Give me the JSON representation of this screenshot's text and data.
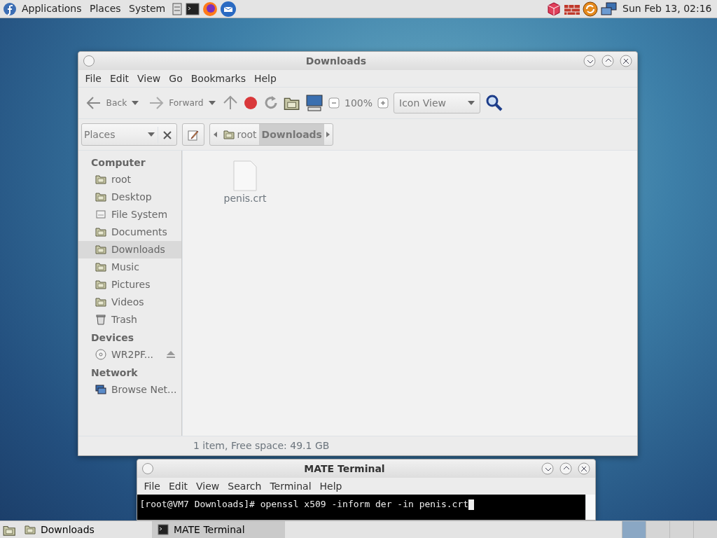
{
  "top_panel": {
    "menus": [
      "Applications",
      "Places",
      "System"
    ],
    "clock": "Sun Feb 13, 02:16"
  },
  "file_manager": {
    "title": "Downloads",
    "menu": [
      "File",
      "Edit",
      "View",
      "Go",
      "Bookmarks",
      "Help"
    ],
    "toolbar": {
      "back": "Back",
      "forward": "Forward",
      "zoom": "100%",
      "view": "Icon View"
    },
    "location": {
      "places": "Places",
      "path": [
        {
          "label": "root",
          "selected": false
        },
        {
          "label": "Downloads",
          "selected": true
        }
      ]
    },
    "sidebar": [
      {
        "heading": "Computer",
        "items": [
          {
            "label": "root",
            "kind": "home",
            "selected": false
          },
          {
            "label": "Desktop",
            "kind": "folder",
            "selected": false
          },
          {
            "label": "File System",
            "kind": "drive",
            "selected": false
          },
          {
            "label": "Documents",
            "kind": "folder",
            "selected": false
          },
          {
            "label": "Downloads",
            "kind": "folder",
            "selected": true
          },
          {
            "label": "Music",
            "kind": "folder",
            "selected": false
          },
          {
            "label": "Pictures",
            "kind": "folder",
            "selected": false
          },
          {
            "label": "Videos",
            "kind": "folder",
            "selected": false
          },
          {
            "label": "Trash",
            "kind": "trash",
            "selected": false
          }
        ]
      },
      {
        "heading": "Devices",
        "items": [
          {
            "label": "WR2PF...",
            "kind": "disc",
            "selected": false,
            "ejectable": true
          }
        ]
      },
      {
        "heading": "Network",
        "items": [
          {
            "label": "Browse Net...",
            "kind": "network",
            "selected": false
          }
        ]
      }
    ],
    "files": [
      {
        "name": "penis.crt"
      }
    ],
    "status": "1 item, Free space: 49.1 GB"
  },
  "terminal": {
    "title": "MATE Terminal",
    "menu": [
      "File",
      "Edit",
      "View",
      "Search",
      "Terminal",
      "Help"
    ],
    "line": "[root@VM7 Downloads]# openssl x509 -inform der -in penis.crt"
  },
  "taskbar": [
    {
      "label": "Downloads",
      "selected": false
    },
    {
      "label": "MATE Terminal",
      "selected": true
    }
  ],
  "workspaces": [
    {
      "selected": true
    },
    {
      "selected": false
    },
    {
      "selected": false
    },
    {
      "selected": false
    }
  ]
}
